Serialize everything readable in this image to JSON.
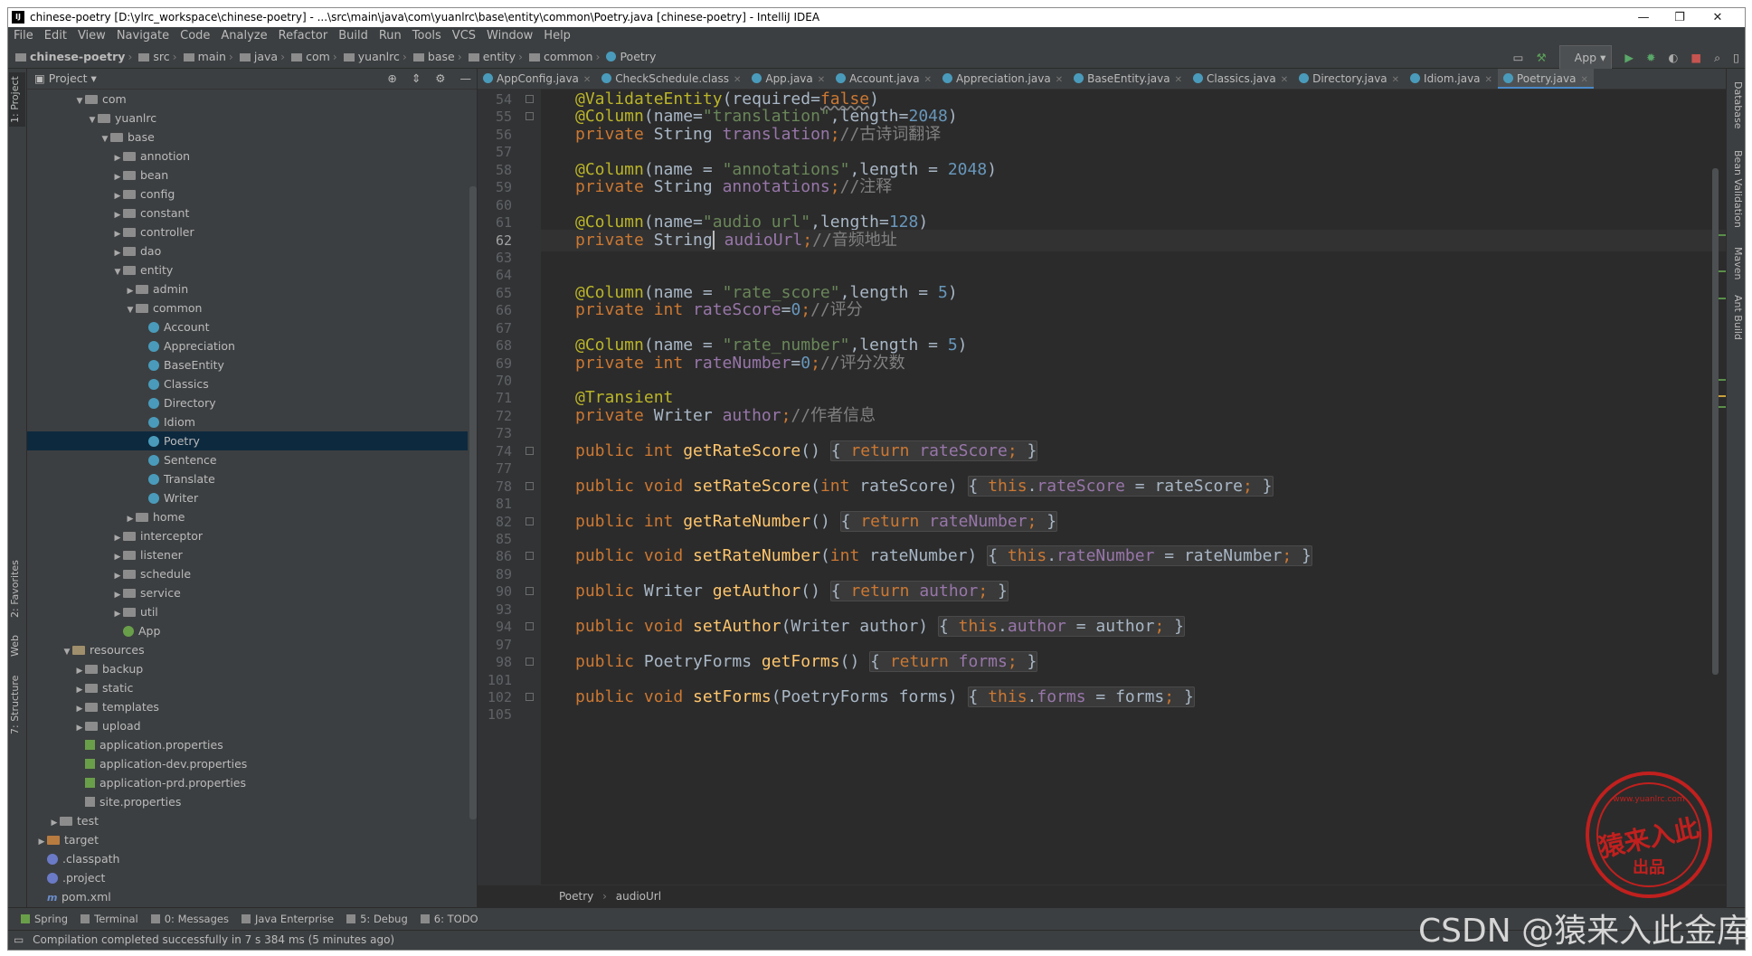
{
  "window": {
    "title": "chinese-poetry [D:\\ylrc_workspace\\chinese-poetry] - ...\\src\\main\\java\\com\\yuanlrc\\base\\entity\\common\\Poetry.java [chinese-poetry] - IntelliJ IDEA",
    "app_icon": "IJ"
  },
  "menu": [
    "File",
    "Edit",
    "View",
    "Navigate",
    "Code",
    "Analyze",
    "Refactor",
    "Build",
    "Run",
    "Tools",
    "VCS",
    "Window",
    "Help"
  ],
  "breadcrumbs": [
    "chinese-poetry",
    "src",
    "main",
    "java",
    "com",
    "yuanlrc",
    "base",
    "entity",
    "common",
    "Poetry"
  ],
  "run_config": "App",
  "project_panel": {
    "title": "Project"
  },
  "tree": [
    {
      "label": "com",
      "depth": 4,
      "type": "folder",
      "open": true
    },
    {
      "label": "yuanlrc",
      "depth": 5,
      "type": "folder",
      "open": true
    },
    {
      "label": "base",
      "depth": 6,
      "type": "folder",
      "open": true
    },
    {
      "label": "annotion",
      "depth": 7,
      "type": "folder",
      "open": false
    },
    {
      "label": "bean",
      "depth": 7,
      "type": "folder",
      "open": false
    },
    {
      "label": "config",
      "depth": 7,
      "type": "folder",
      "open": false
    },
    {
      "label": "constant",
      "depth": 7,
      "type": "folder",
      "open": false
    },
    {
      "label": "controller",
      "depth": 7,
      "type": "folder",
      "open": false
    },
    {
      "label": "dao",
      "depth": 7,
      "type": "folder",
      "open": false
    },
    {
      "label": "entity",
      "depth": 7,
      "type": "folder",
      "open": true
    },
    {
      "label": "admin",
      "depth": 8,
      "type": "folder",
      "open": false
    },
    {
      "label": "common",
      "depth": 8,
      "type": "folder",
      "open": true
    },
    {
      "label": "Account",
      "depth": 9,
      "type": "class"
    },
    {
      "label": "Appreciation",
      "depth": 9,
      "type": "class"
    },
    {
      "label": "BaseEntity",
      "depth": 9,
      "type": "class"
    },
    {
      "label": "Classics",
      "depth": 9,
      "type": "class"
    },
    {
      "label": "Directory",
      "depth": 9,
      "type": "class"
    },
    {
      "label": "Idiom",
      "depth": 9,
      "type": "class"
    },
    {
      "label": "Poetry",
      "depth": 9,
      "type": "class",
      "selected": true
    },
    {
      "label": "Sentence",
      "depth": 9,
      "type": "class"
    },
    {
      "label": "Translate",
      "depth": 9,
      "type": "class"
    },
    {
      "label": "Writer",
      "depth": 9,
      "type": "class"
    },
    {
      "label": "home",
      "depth": 8,
      "type": "folder",
      "open": false
    },
    {
      "label": "interceptor",
      "depth": 7,
      "type": "folder",
      "open": false
    },
    {
      "label": "listener",
      "depth": 7,
      "type": "folder",
      "open": false
    },
    {
      "label": "schedule",
      "depth": 7,
      "type": "folder",
      "open": false
    },
    {
      "label": "service",
      "depth": 7,
      "type": "folder",
      "open": false
    },
    {
      "label": "util",
      "depth": 7,
      "type": "folder",
      "open": false
    },
    {
      "label": "App",
      "depth": 7,
      "type": "spring-class"
    },
    {
      "label": "resources",
      "depth": 3,
      "type": "res-folder",
      "open": true
    },
    {
      "label": "backup",
      "depth": 4,
      "type": "folder",
      "open": false
    },
    {
      "label": "static",
      "depth": 4,
      "type": "folder",
      "open": false
    },
    {
      "label": "templates",
      "depth": 4,
      "type": "folder",
      "open": false
    },
    {
      "label": "upload",
      "depth": 4,
      "type": "folder",
      "open": false
    },
    {
      "label": "application.properties",
      "depth": 4,
      "type": "prop"
    },
    {
      "label": "application-dev.properties",
      "depth": 4,
      "type": "prop"
    },
    {
      "label": "application-prd.properties",
      "depth": 4,
      "type": "prop"
    },
    {
      "label": "site.properties",
      "depth": 4,
      "type": "prop-plain"
    },
    {
      "label": "test",
      "depth": 2,
      "type": "folder",
      "open": false
    },
    {
      "label": "target",
      "depth": 1,
      "type": "target-folder",
      "open": false
    },
    {
      "label": ".classpath",
      "depth": 1,
      "type": "dot"
    },
    {
      "label": ".project",
      "depth": 1,
      "type": "dot"
    },
    {
      "label": "pom.xml",
      "depth": 1,
      "type": "xml"
    }
  ],
  "tabs": [
    {
      "label": "AppConfig.java"
    },
    {
      "label": "CheckSchedule.class"
    },
    {
      "label": "App.java"
    },
    {
      "label": "Account.java"
    },
    {
      "label": "Appreciation.java"
    },
    {
      "label": "BaseEntity.java"
    },
    {
      "label": "Classics.java"
    },
    {
      "label": "Directory.java"
    },
    {
      "label": "Idiom.java"
    },
    {
      "label": "Poetry.java",
      "active": true
    }
  ],
  "left_strip": [
    "1: Project",
    "2: Favorites",
    "Web",
    "7: Structure"
  ],
  "right_strip": [
    "Database",
    "Bean Validation",
    "Maven",
    "Ant Build"
  ],
  "code": {
    "current_line": 62,
    "lines": [
      {
        "n": 54,
        "fold": true,
        "html": "<span class=\"ann\">@ValidateEntity</span>(required=<span class=\"kw\" style=\"text-decoration:underline wavy #808080\">false</span>)"
      },
      {
        "n": 55,
        "fold": true,
        "html": "<span class=\"ann\">@Column</span>(name=<span class=\"str\">\"translation\"</span>,length=<span class=\"num\">2048</span>)"
      },
      {
        "n": 56,
        "html": "<span class=\"kw\">private </span>String <span class=\"fld\">translation</span><span class=\"kw\">;</span><span class=\"cm\">//古诗词翻译</span>"
      },
      {
        "n": 57,
        "html": ""
      },
      {
        "n": 58,
        "html": "<span class=\"ann\">@Column</span>(name = <span class=\"str\">\"annotations\"</span>,length = <span class=\"num\">2048</span>)"
      },
      {
        "n": 59,
        "html": "<span class=\"kw\">private </span>String <span class=\"fld\">annotations</span><span class=\"kw\">;</span><span class=\"cm\">//注释</span>"
      },
      {
        "n": 60,
        "html": ""
      },
      {
        "n": 61,
        "html": "<span class=\"ann\">@Column</span>(name=<span class=\"str\">\"audio_url\"</span>,length=<span class=\"num\">128</span>)"
      },
      {
        "n": 62,
        "html": "<span class=\"kw\">private </span>String<span style=\"border-left:2px solid #bbb\"></span> <span class=\"fld\">audioUrl</span><span class=\"kw\">;</span><span class=\"cm\">//音频地址</span>"
      },
      {
        "n": 63,
        "html": ""
      },
      {
        "n": 64,
        "html": ""
      },
      {
        "n": 65,
        "html": "<span class=\"ann\">@Column</span>(name = <span class=\"str\">\"rate_score\"</span>,length = <span class=\"num\">5</span>)"
      },
      {
        "n": 66,
        "html": "<span class=\"kw\">private int </span><span class=\"fld\">rateScore</span>=<span class=\"num\">0</span><span class=\"kw\">;</span><span class=\"cm\">//评分</span>"
      },
      {
        "n": 67,
        "html": ""
      },
      {
        "n": 68,
        "html": "<span class=\"ann\">@Column</span>(name = <span class=\"str\">\"rate_number\"</span>,length = <span class=\"num\">5</span>)"
      },
      {
        "n": 69,
        "html": "<span class=\"kw\">private int </span><span class=\"fld\">rateNumber</span>=<span class=\"num\">0</span><span class=\"kw\">;</span><span class=\"cm\">//评分次数</span>"
      },
      {
        "n": 70,
        "html": ""
      },
      {
        "n": 71,
        "html": "<span class=\"ann\">@Transient</span>"
      },
      {
        "n": 72,
        "html": "<span class=\"kw\">private </span>Writer <span class=\"fld\">author</span><span class=\"kw\">;</span><span class=\"cm\">//作者信息</span>"
      },
      {
        "n": 73,
        "html": ""
      },
      {
        "n": 74,
        "fold": true,
        "html": "<span class=\"kw\">public int </span><span class=\"fn\">getRateScore</span>() <span class=\"fold-in\">{ <span class=\"kw\">return </span><span class=\"fld\">rateScore</span><span class=\"kw\">;</span> }</span>"
      },
      {
        "n": 77,
        "html": ""
      },
      {
        "n": 78,
        "fold": true,
        "html": "<span class=\"kw\">public void </span><span class=\"fn\">setRateScore</span>(<span class=\"kw\">int </span>rateScore) <span class=\"fold-in\">{ <span class=\"kw\">this</span>.<span class=\"fld\">rateScore</span> = rateScore<span class=\"kw\">;</span> }</span>"
      },
      {
        "n": 81,
        "html": ""
      },
      {
        "n": 82,
        "fold": true,
        "html": "<span class=\"kw\">public int </span><span class=\"fn\">getRateNumber</span>() <span class=\"fold-in\">{ <span class=\"kw\">return </span><span class=\"fld\">rateNumber</span><span class=\"kw\">;</span> }</span>"
      },
      {
        "n": 85,
        "html": ""
      },
      {
        "n": 86,
        "fold": true,
        "html": "<span class=\"kw\">public void </span><span class=\"fn\">setRateNumber</span>(<span class=\"kw\">int </span>rateNumber) <span class=\"fold-in\">{ <span class=\"kw\">this</span>.<span class=\"fld\">rateNumber</span> = rateNumber<span class=\"kw\">;</span> }</span>"
      },
      {
        "n": 89,
        "html": ""
      },
      {
        "n": 90,
        "fold": true,
        "html": "<span class=\"kw\">public </span>Writer <span class=\"fn\">getAuthor</span>() <span class=\"fold-in\">{ <span class=\"kw\">return </span><span class=\"fld\">author</span><span class=\"kw\">;</span> }</span>"
      },
      {
        "n": 93,
        "html": ""
      },
      {
        "n": 94,
        "fold": true,
        "html": "<span class=\"kw\">public void </span><span class=\"fn\">setAuthor</span>(Writer author) <span class=\"fold-in\">{ <span class=\"kw\">this</span>.<span class=\"fld\">author</span> = author<span class=\"kw\">;</span> }</span>"
      },
      {
        "n": 97,
        "html": ""
      },
      {
        "n": 98,
        "fold": true,
        "html": "<span class=\"kw\">public </span>PoetryForms <span class=\"fn\">getForms</span>() <span class=\"fold-in\">{ <span class=\"kw\">return </span><span class=\"fld\">forms</span><span class=\"kw\">;</span> }</span>"
      },
      {
        "n": 101,
        "html": ""
      },
      {
        "n": 102,
        "fold": true,
        "html": "<span class=\"kw\">public void </span><span class=\"fn\">setForms</span>(PoetryForms forms) <span class=\"fold-in\">{ <span class=\"kw\">this</span>.<span class=\"fld\">forms</span> = forms<span class=\"kw\">;</span> }</span>"
      },
      {
        "n": 105,
        "html": ""
      }
    ]
  },
  "editor_breadcrumb": [
    "Poetry",
    "audioUrl"
  ],
  "tool_windows": [
    "Spring",
    "Terminal",
    "0: Messages",
    "Java Enterprise",
    "5: Debug",
    "6: TODO"
  ],
  "status": {
    "message": "Compilation completed successfully in 7 s 384 ms (5 minutes ago)"
  },
  "stamp": {
    "url": "www.yuanlrc.com",
    "big": "猿来入此",
    "small": "出品"
  },
  "watermark": "CSDN @猿来入此金库",
  "colors": {
    "editor_bg": "#2b2b2b",
    "panel_bg": "#3c3f41",
    "keyword": "#cc7832",
    "string": "#6a8759",
    "annotation": "#bbb529",
    "field": "#9876aa",
    "selection": "#0d293e"
  }
}
